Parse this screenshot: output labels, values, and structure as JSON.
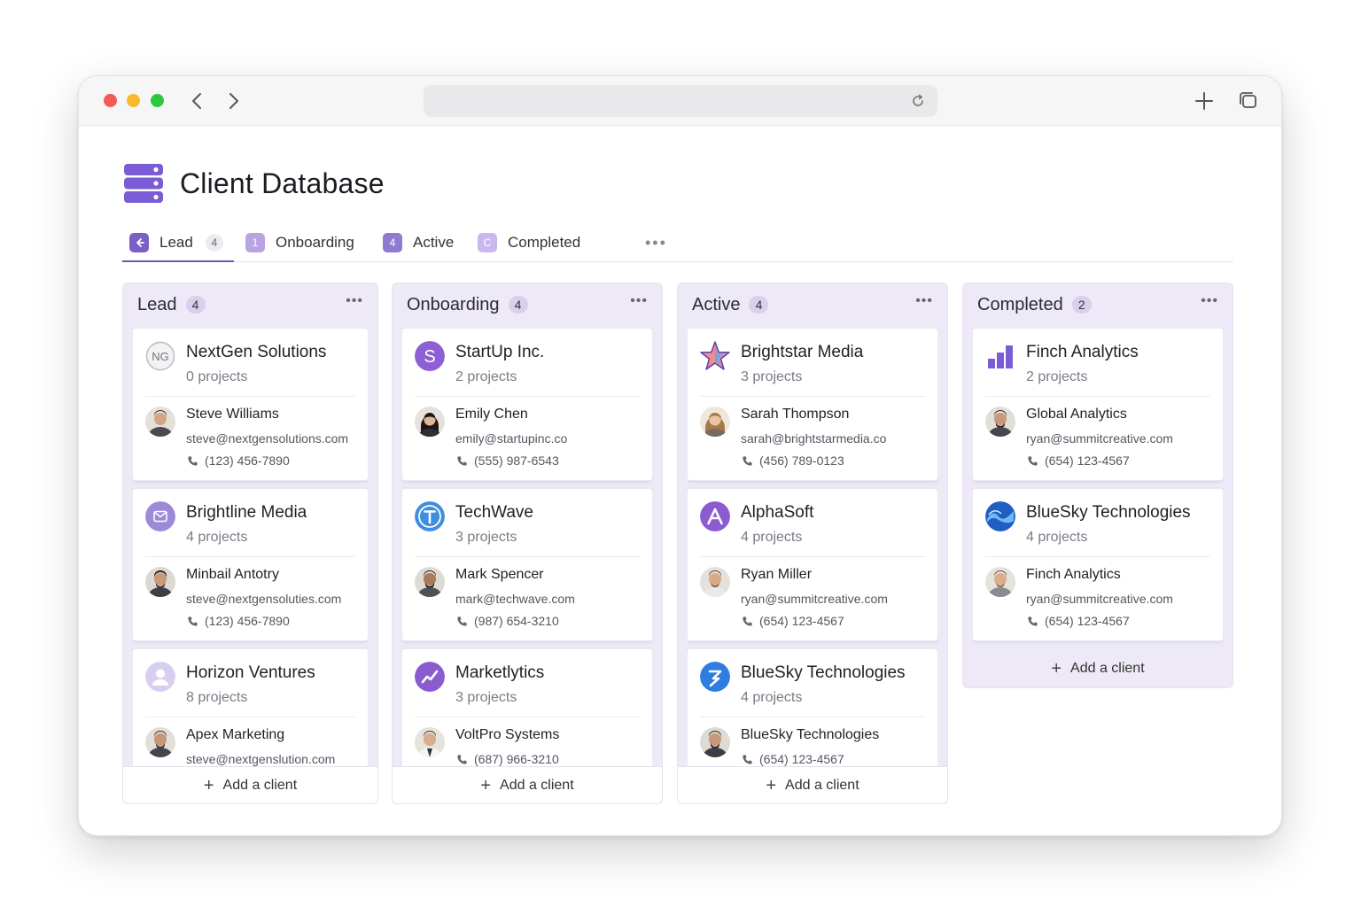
{
  "page": {
    "title": "Client Database"
  },
  "tabs": [
    {
      "label": "Lead",
      "badge": "",
      "count": "4",
      "color": "#7a5fc9"
    },
    {
      "label": "Onboarding",
      "badge": "1",
      "color": "#b9a3e3"
    },
    {
      "label": "Active",
      "badge": "4",
      "color": "#8f7ad1"
    },
    {
      "label": "Completed",
      "badge": "C",
      "color": "#c9b8ee"
    }
  ],
  "add_label": "Add a client",
  "columns": [
    {
      "title": "Lead",
      "count": "4",
      "cards": [
        {
          "company": "NextGen Solutions",
          "logo_text": "NG",
          "projects": "0 projects",
          "contact": "Steve Williams",
          "email": "steve@nextgensolutions.com",
          "phone": "(123) 456-7890"
        },
        {
          "company": "Brightline Media",
          "projects": "4 projects",
          "contact": "Minbail Antotry",
          "email": "steve@nextgensoluties.com",
          "phone": "(123) 456-7890"
        },
        {
          "company": "Horizon Ventures",
          "projects": "8 projects",
          "contact": "Apex Marketing",
          "email": "steve@nextgenslution.com"
        }
      ]
    },
    {
      "title": "Onboarding",
      "count": "4",
      "cards": [
        {
          "company": "StartUp Inc.",
          "logo_text": "S",
          "projects": "2 projects",
          "contact": "Emily Chen",
          "email": "emily@startupinc.co",
          "phone": "(555) 987-6543"
        },
        {
          "company": "TechWave",
          "projects": "3 projects",
          "contact": "Mark Spencer",
          "email": "mark@techwave.com",
          "phone": "(987) 654-3210"
        },
        {
          "company": "Marketlytics",
          "projects": "3 projects",
          "contact": "VoltPro Systems",
          "phone": "(687) 966-3210"
        }
      ]
    },
    {
      "title": "Active",
      "count": "4",
      "cards": [
        {
          "company": "Brightstar Media",
          "projects": "3 projects",
          "contact": "Sarah Thompson",
          "email": "sarah@brightstarmedia.co",
          "phone": "(456) 789-0123"
        },
        {
          "company": "AlphaSoft",
          "projects": "4 projects",
          "contact": "Ryan Miller",
          "email": "ryan@summitcreative.com",
          "phone": "(654) 123-4567"
        },
        {
          "company": "BlueSky Technologies",
          "projects": "4 projects",
          "contact": "BlueSky Technologies",
          "phone": "(654) 123-4567"
        }
      ]
    },
    {
      "title": "Completed",
      "count": "2",
      "cards": [
        {
          "company": "Finch Analytics",
          "projects": "2 projects",
          "contact": "Global Analytics",
          "email": "ryan@summitcreative.com",
          "phone": "(654) 123-4567"
        },
        {
          "company": "BlueSky Technologies",
          "projects": "4 projects",
          "contact": "Finch Analytics",
          "email": "ryan@summitcreative.com",
          "phone": "(654) 123-4567"
        }
      ]
    }
  ]
}
